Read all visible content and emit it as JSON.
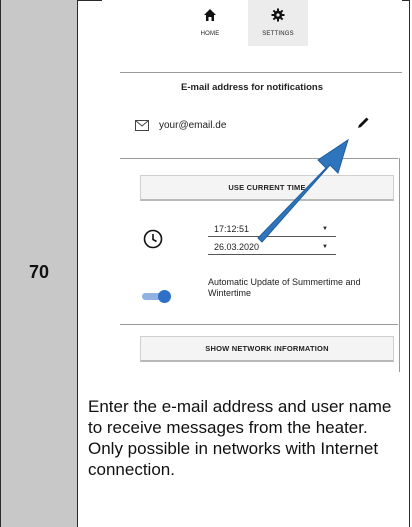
{
  "step": {
    "number": "70"
  },
  "nav": {
    "home_label": "HOME",
    "settings_label": "SETTINGS",
    "home_icon": "home-icon",
    "settings_icon": "gear-icon"
  },
  "notifications": {
    "title": "E-mail address for notifications",
    "email_value": "your@email.de",
    "mail_icon": "mail-icon",
    "edit_icon": "pencil-icon"
  },
  "time": {
    "use_current_time_label": "USE CURRENT TIME",
    "time_value": "17:12:51",
    "date_value": "26.03.2020",
    "clock_icon": "clock-icon"
  },
  "dst": {
    "label": "Automatic Update of Summertime and Wintertime",
    "enabled": true
  },
  "network": {
    "show_network_label": "SHOW NETWORK INFORMATION"
  },
  "description": "Enter the e-mail address and user name to receive messages from the heater. Only possible in networks with Internet connection.",
  "colors": {
    "step_column": "#c8c8c8",
    "toggle_on": "#2e6fc8",
    "arrow": "#2f75bd"
  }
}
